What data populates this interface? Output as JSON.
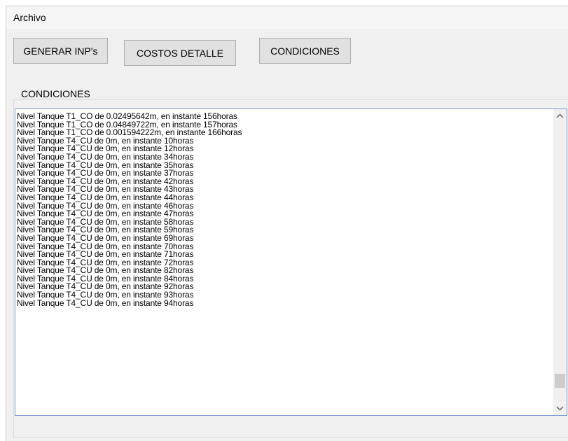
{
  "menu": {
    "archivo": "Archivo"
  },
  "toolbar": {
    "generar_inps": "GENERAR INP's",
    "costos_detalle": "COSTOS DETALLE",
    "condiciones": "CONDICIONES"
  },
  "group": {
    "title": "CONDICIONES"
  },
  "list": {
    "items": [
      "Nivel Tanque T1_CO de 0.02495642m, en instante 156horas",
      "Nivel Tanque T1_CO de 0.04849722m, en instante 157horas",
      "Nivel Tanque T1_CO de 0.001594222m, en instante 166horas",
      "Nivel Tanque T4_CU de 0m, en instante 10horas",
      "Nivel Tanque T4_CU de 0m, en instante 12horas",
      "Nivel Tanque T4_CU de 0m, en instante 34horas",
      "Nivel Tanque T4_CU de 0m, en instante 35horas",
      "Nivel Tanque T4_CU de 0m, en instante 37horas",
      "Nivel Tanque T4_CU de 0m, en instante 42horas",
      "Nivel Tanque T4_CU de 0m, en instante 43horas",
      "Nivel Tanque T4_CU de 0m, en instante 44horas",
      "Nivel Tanque T4_CU de 0m, en instante 46horas",
      "Nivel Tanque T4_CU de 0m, en instante 47horas",
      "Nivel Tanque T4_CU de 0m, en instante 58horas",
      "Nivel Tanque T4_CU de 0m, en instante 59horas",
      "Nivel Tanque T4_CU de 0m, en instante 69horas",
      "Nivel Tanque T4_CU de 0m, en instante 70horas",
      "Nivel Tanque T4_CU de 0m, en instante 71horas",
      "Nivel Tanque T4_CU de 0m, en instante 72horas",
      "Nivel Tanque T4_CU de 0m, en instante 82horas",
      "Nivel Tanque T4_CU de 0m, en instante 84horas",
      "Nivel Tanque T4_CU de 0m, en instante 92horas",
      "Nivel Tanque T4_CU de 0m, en instante 93horas",
      "Nivel Tanque T4_CU de 0m, en instante 94horas"
    ]
  },
  "icons": {
    "scroll_up": "chevron-up-icon",
    "scroll_down": "chevron-down-icon"
  },
  "colors": {
    "window_bg": "#f0f0f0",
    "button_bg": "#e1e1e1",
    "listbox_border": "#7a9cd3"
  }
}
